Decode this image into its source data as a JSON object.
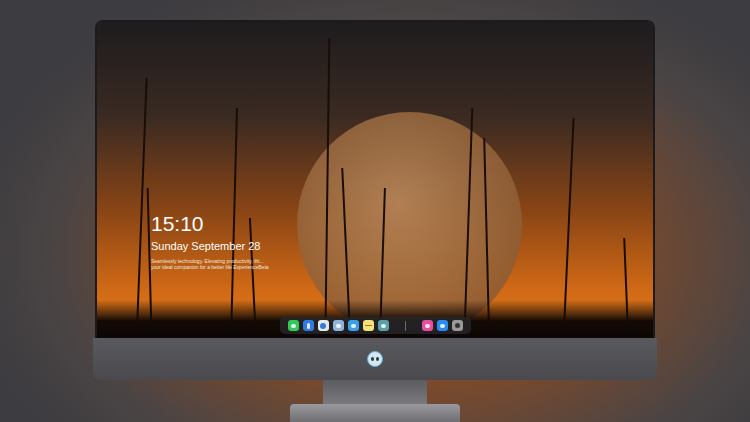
{
  "lockscreen": {
    "time": "15:10",
    "date": "Sunday September 28",
    "tagline": [
      "Seamlessly technology. Elevating productivity, thi...",
      "your ideal companion for a better life ExperienceBeta"
    ]
  },
  "dock": {
    "items": [
      {
        "kind": "messages",
        "color": "#34c759"
      },
      {
        "kind": "finder",
        "color": "#2f7de1"
      },
      {
        "kind": "safari",
        "color": "#e8e8e8"
      },
      {
        "kind": "gallery",
        "color": "#8fb3d9"
      },
      {
        "kind": "video",
        "color": "#3aa0e8"
      },
      {
        "kind": "notes",
        "color": "#f7e27a"
      },
      {
        "kind": "photos",
        "color": "#5aa0a8"
      },
      {
        "kind": "divider",
        "color": "#6b6b6b"
      },
      {
        "kind": "music",
        "color": "#e84ea0"
      },
      {
        "kind": "store",
        "color": "#2a8cf0"
      },
      {
        "kind": "camera",
        "color": "#9a9a9a"
      }
    ]
  }
}
